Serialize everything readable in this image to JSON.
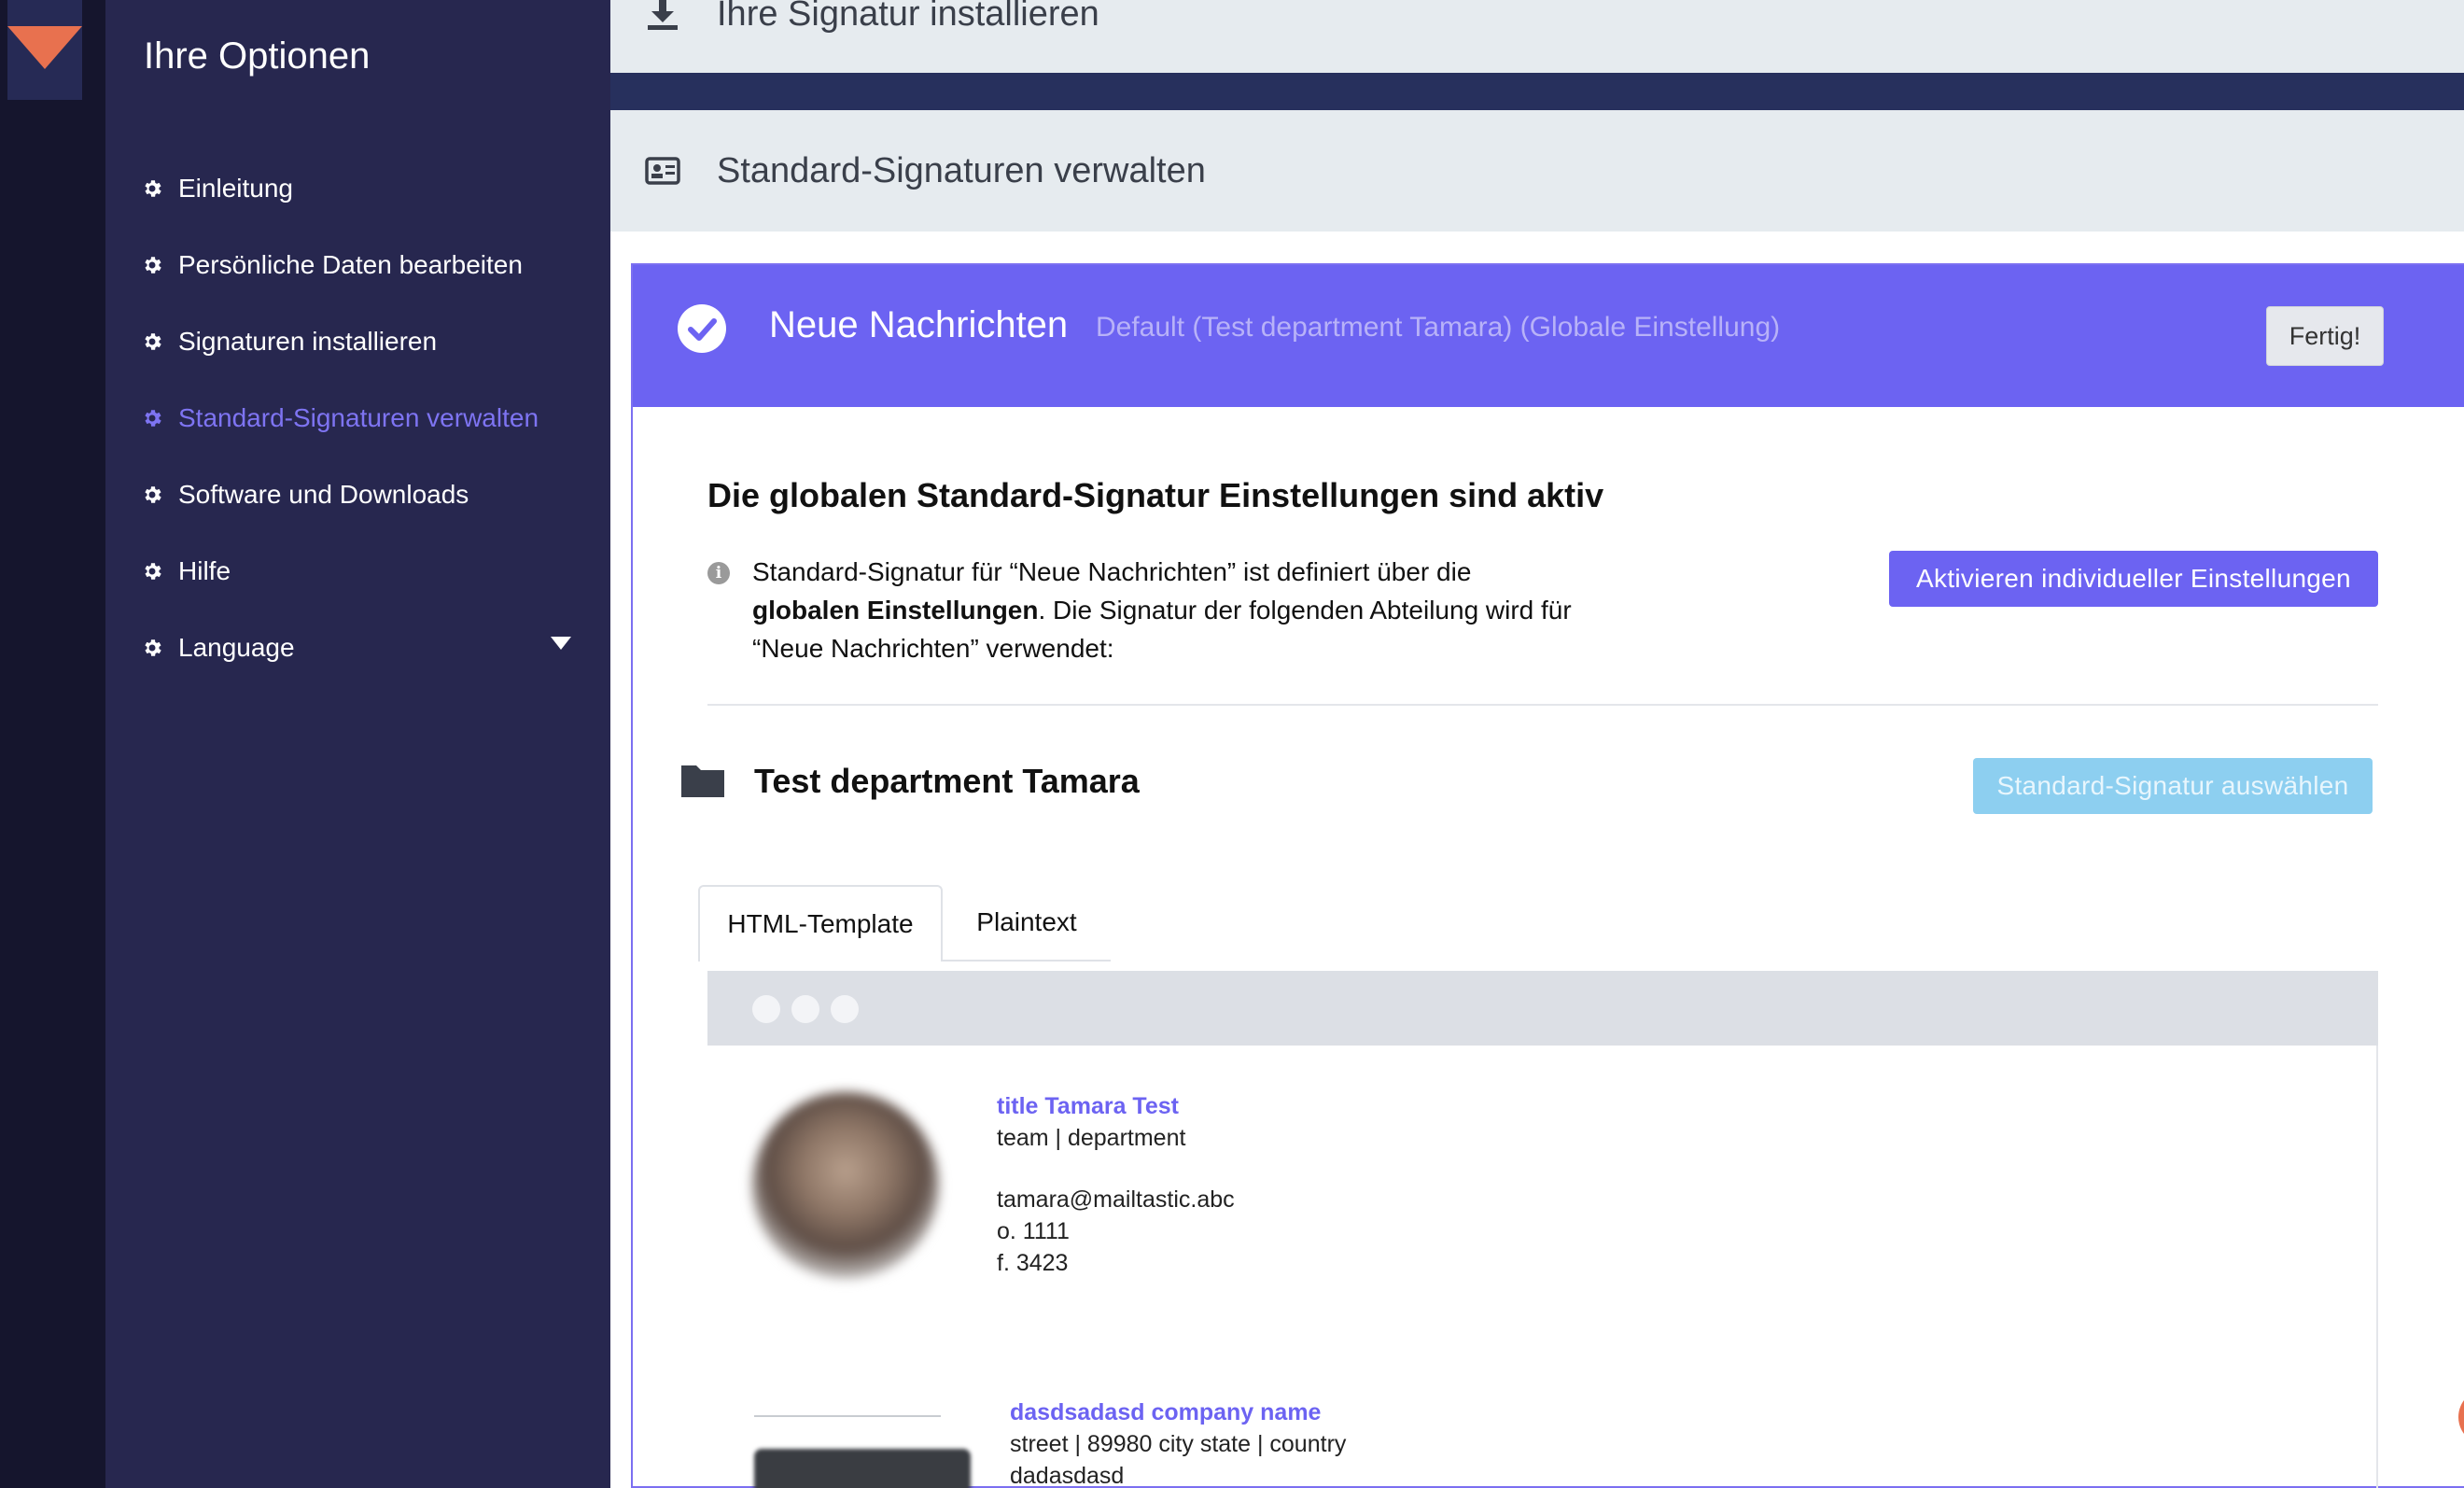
{
  "sidebar": {
    "title": "Ihre Optionen",
    "items": [
      {
        "label": "Einleitung",
        "icon": "gear-icon",
        "active": false
      },
      {
        "label": "Persönliche Daten bearbeiten",
        "icon": "gear-icon",
        "active": false
      },
      {
        "label": "Signaturen installieren",
        "icon": "gear-icon",
        "active": false
      },
      {
        "label": "Standard-Signaturen verwalten",
        "icon": "gear-icon",
        "active": true
      },
      {
        "label": "Software und Downloads",
        "icon": "gear-icon",
        "active": false
      },
      {
        "label": "Hilfe",
        "icon": "gear-icon",
        "active": false
      },
      {
        "label": "Language",
        "icon": "gear-icon",
        "active": false
      }
    ]
  },
  "sections": {
    "install": {
      "label": "Ihre Signatur installieren",
      "icon": "download-icon"
    },
    "manage": {
      "label": "Standard-Signaturen verwalten",
      "icon": "id-card-icon"
    }
  },
  "panel": {
    "title": "Neue Nachrichten",
    "subtitle": "Default (Test department Tamara) (Globale Einstellung)",
    "done_button": "Fertig!",
    "headline": "Die globalen Standard-Signatur Einstellungen sind aktiv",
    "info_part1": "Standard-Signatur für “Neue Nachrichten” ist definiert über die",
    "info_bold": "globalen Einstellungen",
    "info_part2": ". Die Signatur der folgenden Abteilung wird für “Neue Nachrichten” verwendet:",
    "activate_button": "Aktivieren individueller Einstellungen",
    "department": "Test department Tamara",
    "select_button": "Standard-Signatur auswählen",
    "tabs": [
      "HTML-Template",
      "Plaintext"
    ]
  },
  "signature": {
    "name": "title Tamara Test",
    "team": "team | department",
    "email": "tamara@mailtastic.abc",
    "office": "o. 1111",
    "fax": "f. 3423",
    "company": "dasdsadasd company name",
    "address": "street | 89980 city state | country",
    "extra": "dadasdasd",
    "company_logo_glyph": "</>"
  },
  "colors": {
    "accent": "#6c63f2",
    "sidebar": "#27274f",
    "rail": "#15152d",
    "logo": "#e8714f",
    "disabled_button": "#8dcff0"
  }
}
